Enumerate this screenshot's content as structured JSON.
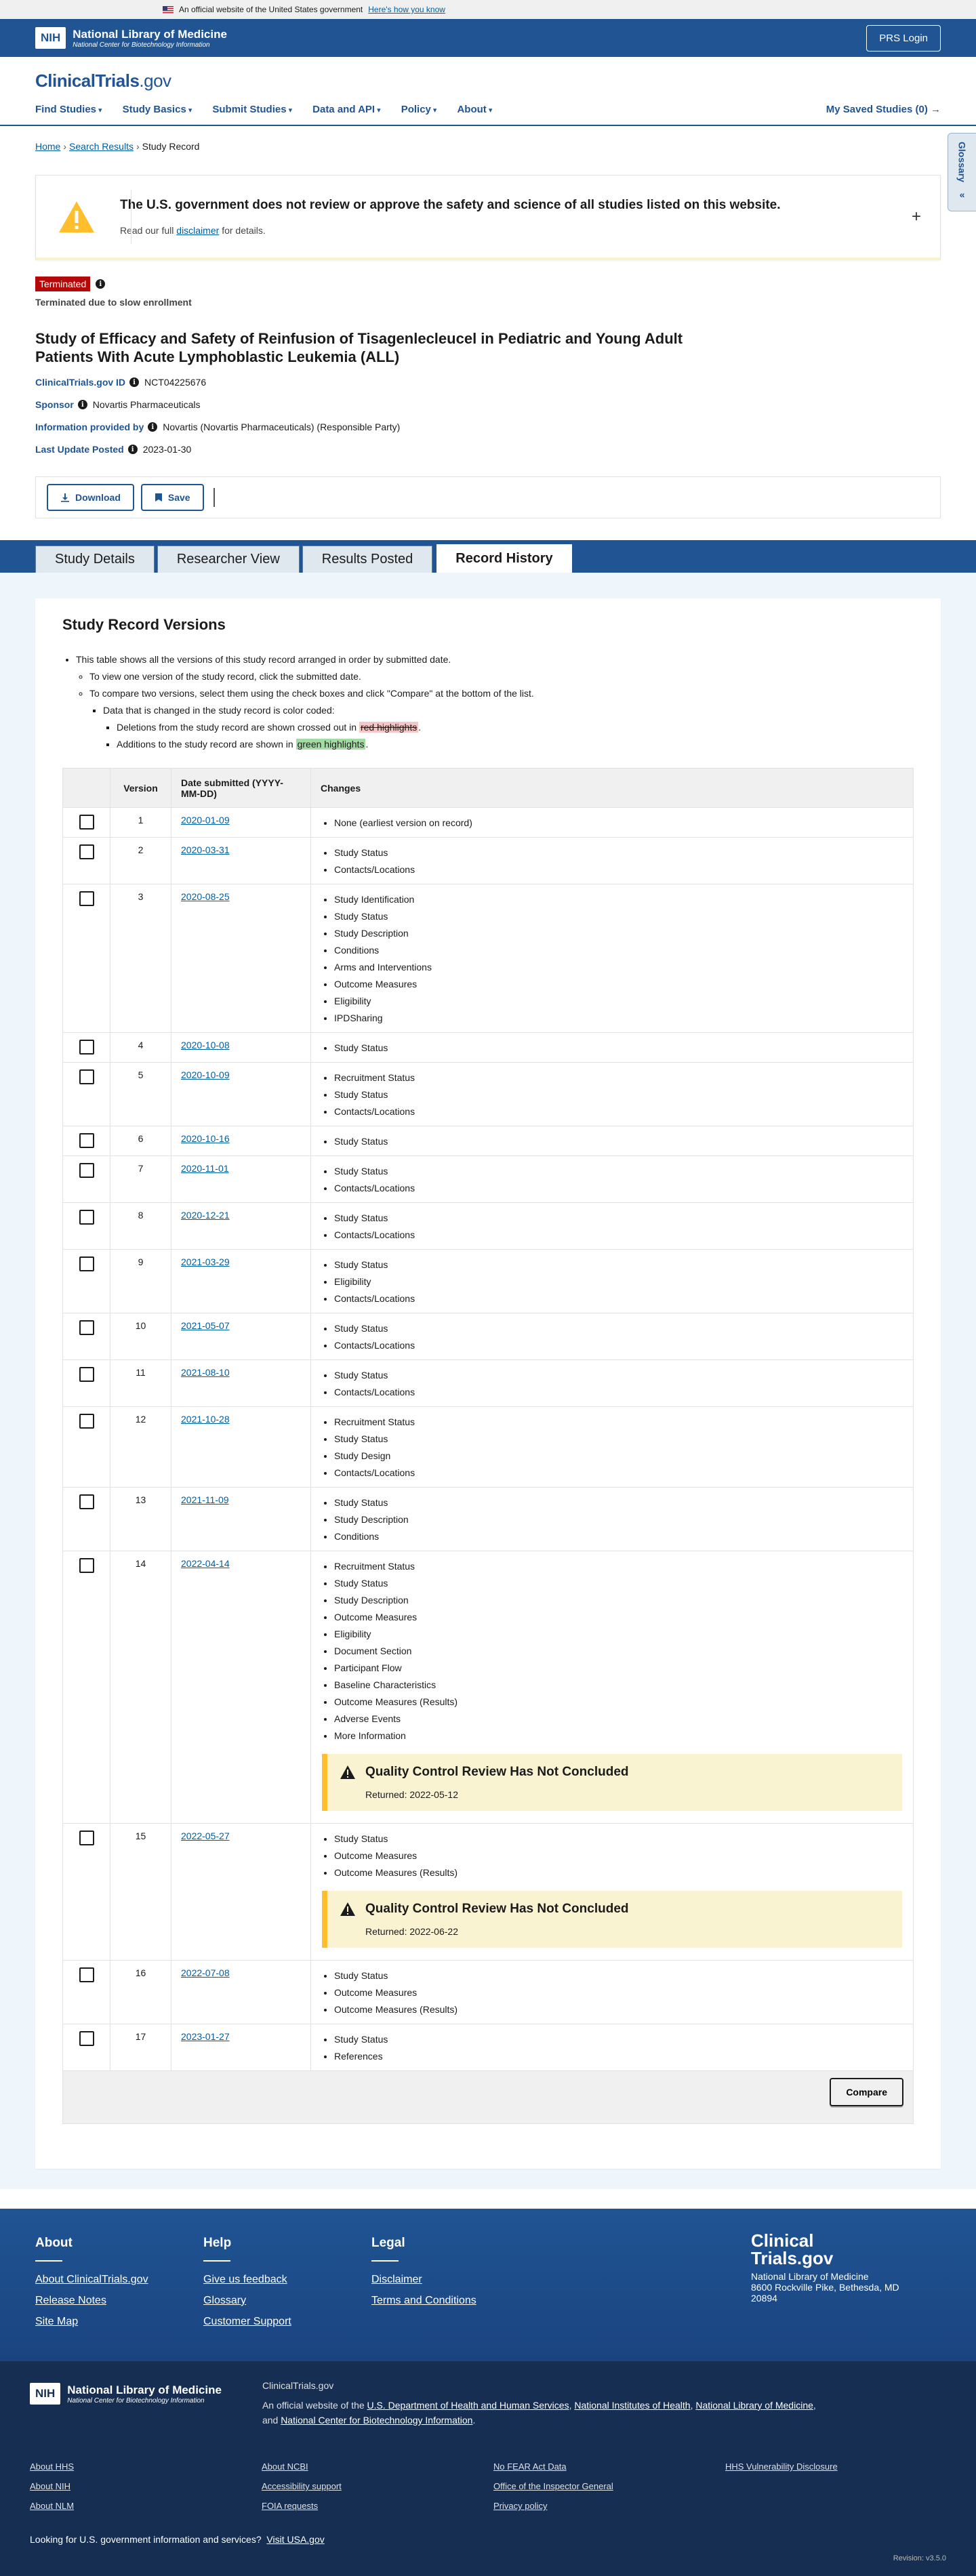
{
  "gov_banner": {
    "text": "An official website of the United States government",
    "link": "Here's how you know"
  },
  "nlm": {
    "nih": "NIH",
    "title": "National Library of Medicine",
    "subtitle": "National Center for Biotechnology Information",
    "prs_login": "PRS Login"
  },
  "ct_logo": {
    "bold": "ClinicalTrials",
    "rest": ".gov"
  },
  "nav": {
    "items": [
      "Find Studies",
      "Study Basics",
      "Submit Studies",
      "Data and API",
      "Policy",
      "About"
    ],
    "saved": "My Saved Studies (0)"
  },
  "glossary": {
    "label": "Glossary"
  },
  "breadcrumb": {
    "home": "Home",
    "search": "Search Results",
    "current": "Study Record"
  },
  "alert": {
    "title": "The U.S. government does not review or approve the safety and science of all studies listed on this website.",
    "pre": "Read our full",
    "link": "disclaimer",
    "post": "for details."
  },
  "status": {
    "badge": "Terminated",
    "reason": "Terminated due to slow enrollment"
  },
  "study": {
    "title": "Study of Efficacy and Safety of Reinfusion of Tisagenlecleucel in Pediatric and Young Adult Patients With Acute Lymphoblastic Leukemia (ALL)",
    "id_label": "ClinicalTrials.gov ID",
    "id_value": "NCT04225676",
    "sponsor_label": "Sponsor",
    "sponsor_value": "Novartis Pharmaceuticals",
    "provided_label": "Information provided by",
    "provided_value": "Novartis (Novartis Pharmaceuticals) (Responsible Party)",
    "update_label": "Last Update Posted",
    "update_value": "2023-01-30"
  },
  "actions": {
    "download": "Download",
    "save": "Save"
  },
  "tabs": [
    "Study Details",
    "Researcher View",
    "Results Posted",
    "Record History"
  ],
  "history": {
    "heading": "Study Record Versions",
    "note1": "This table shows all the versions of this study record arranged in order by submitted date.",
    "note2": "To view one version of the study record, click the submitted date.",
    "note3": "To compare two versions, select them using the check boxes and click \"Compare\" at the bottom of the list.",
    "note4": "Data that is changed in the study record is color coded:",
    "del_pre": "Deletions from the study record are shown crossed out in",
    "del_hl": "red highlights",
    "add_pre": "Additions to the study record are shown in",
    "add_hl": "green highlights",
    "col_version": "Version",
    "col_date": "Date submitted (YYYY-MM-DD)",
    "col_changes": "Changes",
    "compare": "Compare",
    "qc_title": "Quality Control Review Has Not Concluded",
    "rows": [
      {
        "v": "1",
        "d": "2020-01-09",
        "c": [
          "None (earliest version on record)"
        ]
      },
      {
        "v": "2",
        "d": "2020-03-31",
        "c": [
          "Study Status",
          "Contacts/Locations"
        ]
      },
      {
        "v": "3",
        "d": "2020-08-25",
        "c": [
          "Study Identification",
          "Study Status",
          "Study Description",
          "Conditions",
          "Arms and Interventions",
          "Outcome Measures",
          "Eligibility",
          "IPDSharing"
        ]
      },
      {
        "v": "4",
        "d": "2020-10-08",
        "c": [
          "Study Status"
        ]
      },
      {
        "v": "5",
        "d": "2020-10-09",
        "c": [
          "Recruitment Status",
          "Study Status",
          "Contacts/Locations"
        ]
      },
      {
        "v": "6",
        "d": "2020-10-16",
        "c": [
          "Study Status"
        ]
      },
      {
        "v": "7",
        "d": "2020-11-01",
        "c": [
          "Study Status",
          "Contacts/Locations"
        ]
      },
      {
        "v": "8",
        "d": "2020-12-21",
        "c": [
          "Study Status",
          "Contacts/Locations"
        ]
      },
      {
        "v": "9",
        "d": "2021-03-29",
        "c": [
          "Study Status",
          "Eligibility",
          "Contacts/Locations"
        ]
      },
      {
        "v": "10",
        "d": "2021-05-07",
        "c": [
          "Study Status",
          "Contacts/Locations"
        ]
      },
      {
        "v": "11",
        "d": "2021-08-10",
        "c": [
          "Study Status",
          "Contacts/Locations"
        ]
      },
      {
        "v": "12",
        "d": "2021-10-28",
        "c": [
          "Recruitment Status",
          "Study Status",
          "Study Design",
          "Contacts/Locations"
        ]
      },
      {
        "v": "13",
        "d": "2021-11-09",
        "c": [
          "Study Status",
          "Study Description",
          "Conditions"
        ]
      },
      {
        "v": "14",
        "d": "2022-04-14",
        "c": [
          "Recruitment Status",
          "Study Status",
          "Study Description",
          "Outcome Measures",
          "Eligibility",
          "Document Section",
          "Participant Flow",
          "Baseline Characteristics",
          "Outcome Measures (Results)",
          "Adverse Events",
          "More Information"
        ],
        "qc": "Returned: 2022-05-12"
      },
      {
        "v": "15",
        "d": "2022-05-27",
        "c": [
          "Study Status",
          "Outcome Measures",
          "Outcome Measures (Results)"
        ],
        "qc": "Returned: 2022-06-22"
      },
      {
        "v": "16",
        "d": "2022-07-08",
        "c": [
          "Study Status",
          "Outcome Measures",
          "Outcome Measures (Results)"
        ]
      },
      {
        "v": "17",
        "d": "2023-01-27",
        "c": [
          "Study Status",
          "References"
        ]
      }
    ]
  },
  "footer": {
    "about": {
      "title": "About",
      "links": [
        "About ClinicalTrials.gov",
        "Release Notes",
        "Site Map"
      ]
    },
    "help": {
      "title": "Help",
      "links": [
        "Give us feedback",
        "Glossary",
        "Customer Support"
      ]
    },
    "legal": {
      "title": "Legal",
      "links": [
        "Disclaimer",
        "Terms and Conditions"
      ]
    },
    "brand1": "Clinical",
    "brand2": "Trials.gov",
    "address1": "National Library of Medicine",
    "address2": "8600 Rockville Pike, Bethesda, MD 20894",
    "ct_label": "ClinicalTrials.gov",
    "official_pre": "An official website of the",
    "hhs": "U.S. Department of Health and Human Services",
    "nih": "National Institutes of Health",
    "nlm": "National Library of Medicine",
    "and": "and",
    "ncbi": "National Center for Biotechnology Information",
    "bottom_links": [
      "About HHS",
      "About NCBI",
      "No FEAR Act Data",
      "HHS Vulnerability Disclosure",
      "About NIH",
      "Accessibility support",
      "Office of the Inspector General",
      "",
      "About NLM",
      "FOIA requests",
      "Privacy policy",
      ""
    ],
    "usa_pre": "Looking for U.S. government information and services?",
    "usa_link": "Visit USA.gov",
    "revision": "Revision: v3.5.0"
  }
}
